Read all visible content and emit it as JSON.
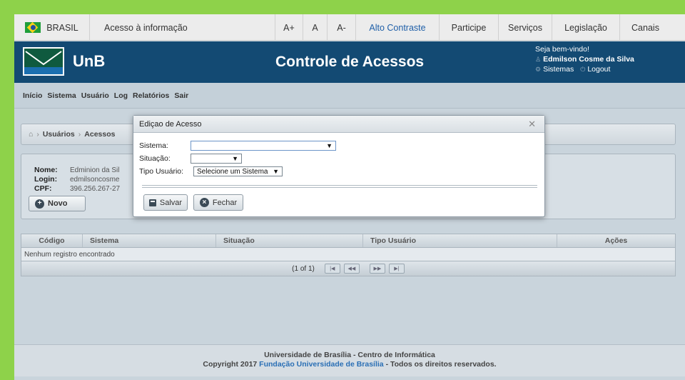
{
  "govbar": {
    "country": "BRASIL",
    "acesso": "Acesso à informação",
    "font_plus": "A+",
    "font_normal": "A",
    "font_minus": "A-",
    "contrast": "Alto Contraste",
    "participe": "Participe",
    "servicos": "Serviços",
    "legislacao": "Legislação",
    "canais": "Canais"
  },
  "header": {
    "logo_text": "UnB",
    "app_title": "Controle de Acessos",
    "welcome": "Seja bem-vindo!",
    "user_name": "Edmilson Cosme da Silva",
    "sistemas": "Sistemas",
    "logout": "Logout"
  },
  "menu": [
    "Início",
    "Sistema",
    "Usuário",
    "Log",
    "Relatórios",
    "Sair"
  ],
  "breadcrumb": [
    "Usuários",
    "Acessos"
  ],
  "info": {
    "nome_label": "Nome:",
    "nome_value": "Edminion da Sil",
    "login_label": "Login:",
    "login_value": "edmilsoncosme",
    "cpf_label": "CPF:",
    "cpf_value": "396.256.267-27",
    "novo_button": "Novo"
  },
  "table": {
    "columns": [
      "Código",
      "Sistema",
      "Situação",
      "Tipo Usuário",
      "Ações"
    ],
    "empty_message": "Nenhum registro encontrado",
    "pager_text": "(1 of 1)"
  },
  "footer": {
    "line1": "Universidade de Brasília - Centro de Informática",
    "line2_prefix": "Copyright 2017",
    "line2_link": "Fundação Universidade de Brasília",
    "line2_suffix": "- Todos os direitos reservados."
  },
  "dialog": {
    "title": "Ediçao de Acesso",
    "sistema_label": "Sistema:",
    "sistema_value": "",
    "situacao_label": "Situação:",
    "situacao_value": "",
    "tipo_label": "Tipo Usuário:",
    "tipo_value": "Selecione um Sistema",
    "save_button": "Salvar",
    "close_button": "Fechar"
  },
  "colors": {
    "outer_background": "#8ed24a",
    "header_background": "#134a73",
    "link": "#2a6fb5"
  }
}
